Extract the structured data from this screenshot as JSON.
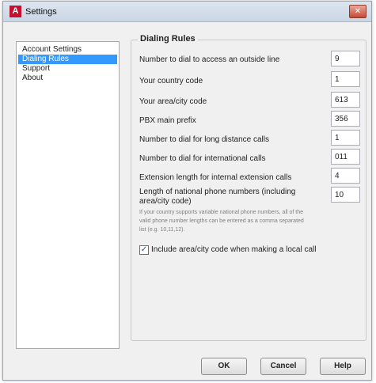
{
  "window": {
    "title": "Settings",
    "app_icon_glyph": "A",
    "close_glyph": "✕"
  },
  "nav": {
    "items": [
      {
        "label": "Account Settings",
        "selected": false
      },
      {
        "label": "Dialing Rules",
        "selected": true
      },
      {
        "label": "Support",
        "selected": false
      },
      {
        "label": "About",
        "selected": false
      }
    ]
  },
  "dialing_rules": {
    "title": "Dialing Rules",
    "rows": [
      {
        "label": "Number to dial to access an outside line",
        "value": "9"
      },
      {
        "label": "Your country code",
        "value": "1"
      },
      {
        "label": "Your area/city code",
        "value": "613"
      },
      {
        "label": "PBX main prefix",
        "value": "356"
      },
      {
        "label": "Number to dial for long distance calls",
        "value": "1"
      },
      {
        "label": "Number to dial for international calls",
        "value": "011"
      },
      {
        "label": "Extension length for internal extension calls",
        "value": "4"
      },
      {
        "label_line1": "Length of national phone numbers (including",
        "label_line2": "area/city code)",
        "value": "10"
      }
    ],
    "hint_line1": "If your country supports variable national phone numbers, all of the",
    "hint_line2": "valid phone number lengths can be entered as a comma separated",
    "hint_line3": "list (e.g. 10,11,12).",
    "checkbox_label": "Include area/city code when making a local call",
    "checkbox_checked": true,
    "check_glyph": "✓"
  },
  "buttons": {
    "ok": "OK",
    "cancel": "Cancel",
    "help": "Help"
  }
}
